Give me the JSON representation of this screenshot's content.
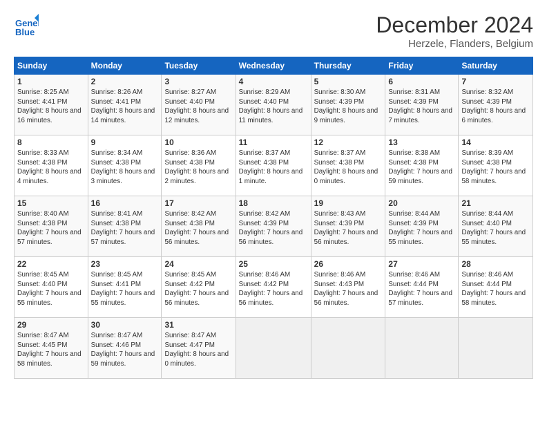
{
  "header": {
    "logo_line1": "General",
    "logo_line2": "Blue",
    "title": "December 2024",
    "subtitle": "Herzele, Flanders, Belgium"
  },
  "weekdays": [
    "Sunday",
    "Monday",
    "Tuesday",
    "Wednesday",
    "Thursday",
    "Friday",
    "Saturday"
  ],
  "weeks": [
    [
      {
        "day": "1",
        "sunrise": "8:25 AM",
        "sunset": "4:41 PM",
        "daylight": "8 hours and 16 minutes."
      },
      {
        "day": "2",
        "sunrise": "8:26 AM",
        "sunset": "4:41 PM",
        "daylight": "8 hours and 14 minutes."
      },
      {
        "day": "3",
        "sunrise": "8:27 AM",
        "sunset": "4:40 PM",
        "daylight": "8 hours and 12 minutes."
      },
      {
        "day": "4",
        "sunrise": "8:29 AM",
        "sunset": "4:40 PM",
        "daylight": "8 hours and 11 minutes."
      },
      {
        "day": "5",
        "sunrise": "8:30 AM",
        "sunset": "4:39 PM",
        "daylight": "8 hours and 9 minutes."
      },
      {
        "day": "6",
        "sunrise": "8:31 AM",
        "sunset": "4:39 PM",
        "daylight": "8 hours and 7 minutes."
      },
      {
        "day": "7",
        "sunrise": "8:32 AM",
        "sunset": "4:39 PM",
        "daylight": "8 hours and 6 minutes."
      }
    ],
    [
      {
        "day": "8",
        "sunrise": "8:33 AM",
        "sunset": "4:38 PM",
        "daylight": "8 hours and 4 minutes."
      },
      {
        "day": "9",
        "sunrise": "8:34 AM",
        "sunset": "4:38 PM",
        "daylight": "8 hours and 3 minutes."
      },
      {
        "day": "10",
        "sunrise": "8:36 AM",
        "sunset": "4:38 PM",
        "daylight": "8 hours and 2 minutes."
      },
      {
        "day": "11",
        "sunrise": "8:37 AM",
        "sunset": "4:38 PM",
        "daylight": "8 hours and 1 minute."
      },
      {
        "day": "12",
        "sunrise": "8:37 AM",
        "sunset": "4:38 PM",
        "daylight": "8 hours and 0 minutes."
      },
      {
        "day": "13",
        "sunrise": "8:38 AM",
        "sunset": "4:38 PM",
        "daylight": "7 hours and 59 minutes."
      },
      {
        "day": "14",
        "sunrise": "8:39 AM",
        "sunset": "4:38 PM",
        "daylight": "7 hours and 58 minutes."
      }
    ],
    [
      {
        "day": "15",
        "sunrise": "8:40 AM",
        "sunset": "4:38 PM",
        "daylight": "7 hours and 57 minutes."
      },
      {
        "day": "16",
        "sunrise": "8:41 AM",
        "sunset": "4:38 PM",
        "daylight": "7 hours and 57 minutes."
      },
      {
        "day": "17",
        "sunrise": "8:42 AM",
        "sunset": "4:38 PM",
        "daylight": "7 hours and 56 minutes."
      },
      {
        "day": "18",
        "sunrise": "8:42 AM",
        "sunset": "4:39 PM",
        "daylight": "7 hours and 56 minutes."
      },
      {
        "day": "19",
        "sunrise": "8:43 AM",
        "sunset": "4:39 PM",
        "daylight": "7 hours and 56 minutes."
      },
      {
        "day": "20",
        "sunrise": "8:44 AM",
        "sunset": "4:39 PM",
        "daylight": "7 hours and 55 minutes."
      },
      {
        "day": "21",
        "sunrise": "8:44 AM",
        "sunset": "4:40 PM",
        "daylight": "7 hours and 55 minutes."
      }
    ],
    [
      {
        "day": "22",
        "sunrise": "8:45 AM",
        "sunset": "4:40 PM",
        "daylight": "7 hours and 55 minutes."
      },
      {
        "day": "23",
        "sunrise": "8:45 AM",
        "sunset": "4:41 PM",
        "daylight": "7 hours and 55 minutes."
      },
      {
        "day": "24",
        "sunrise": "8:45 AM",
        "sunset": "4:42 PM",
        "daylight": "7 hours and 56 minutes."
      },
      {
        "day": "25",
        "sunrise": "8:46 AM",
        "sunset": "4:42 PM",
        "daylight": "7 hours and 56 minutes."
      },
      {
        "day": "26",
        "sunrise": "8:46 AM",
        "sunset": "4:43 PM",
        "daylight": "7 hours and 56 minutes."
      },
      {
        "day": "27",
        "sunrise": "8:46 AM",
        "sunset": "4:44 PM",
        "daylight": "7 hours and 57 minutes."
      },
      {
        "day": "28",
        "sunrise": "8:46 AM",
        "sunset": "4:44 PM",
        "daylight": "7 hours and 58 minutes."
      }
    ],
    [
      {
        "day": "29",
        "sunrise": "8:47 AM",
        "sunset": "4:45 PM",
        "daylight": "7 hours and 58 minutes."
      },
      {
        "day": "30",
        "sunrise": "8:47 AM",
        "sunset": "4:46 PM",
        "daylight": "7 hours and 59 minutes."
      },
      {
        "day": "31",
        "sunrise": "8:47 AM",
        "sunset": "4:47 PM",
        "daylight": "8 hours and 0 minutes."
      },
      null,
      null,
      null,
      null
    ]
  ]
}
